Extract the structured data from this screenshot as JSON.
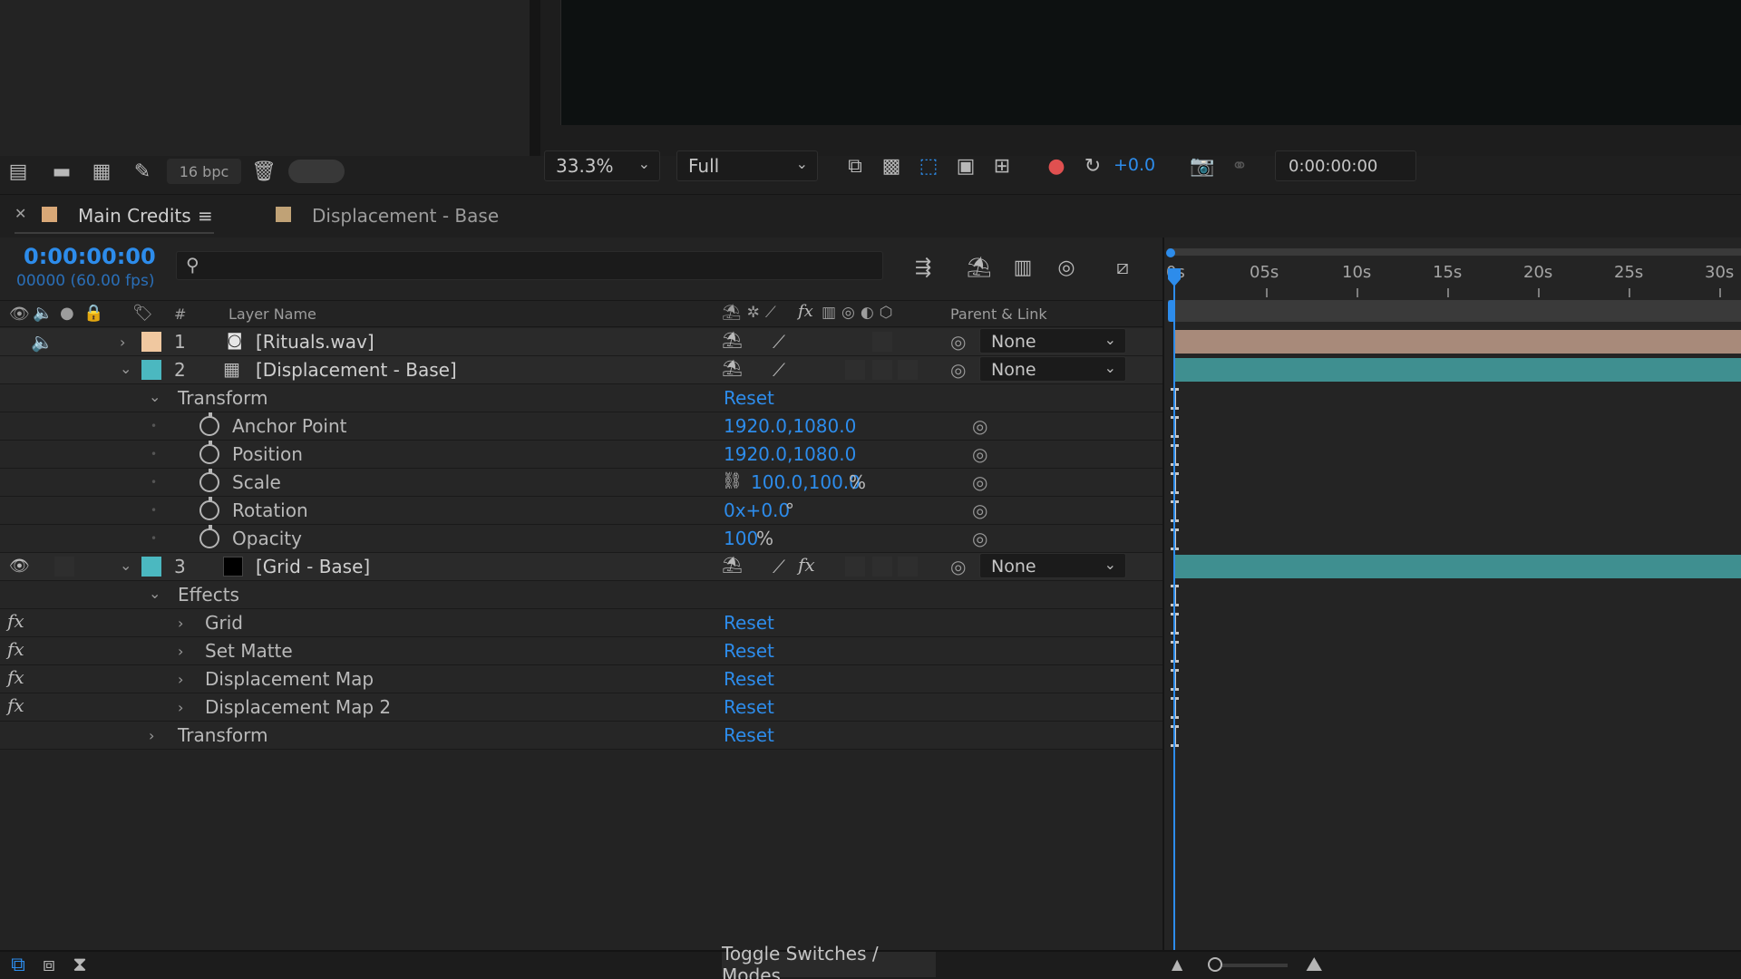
{
  "project_panel": {
    "bpc_label": "16 bpc"
  },
  "viewer": {
    "zoom": "33.3%",
    "resolution": "Full",
    "exposure": "+0.0",
    "timecode": "0:00:00:00"
  },
  "tabs": [
    {
      "label": "Main Credits",
      "active": true,
      "color": "#d9a877"
    },
    {
      "label": "Displacement - Base",
      "active": false,
      "color": "#c0a276"
    }
  ],
  "timeline": {
    "current_time": "0:00:00:00",
    "frame_info": "00000 (60.00 fps)",
    "search_placeholder": "",
    "columns": {
      "number": "#",
      "layer_name": "Layer Name",
      "parent": "Parent & Link"
    },
    "ruler": [
      "0s",
      "05s",
      "10s",
      "15s",
      "20s",
      "25s",
      "30s"
    ],
    "layers": [
      {
        "index": "1",
        "name": "[Rituals.wav]",
        "color": "#f0c8a0",
        "parent": "None",
        "bar_color": "#a88a7a"
      },
      {
        "index": "2",
        "name": "[Displacement - Base]",
        "color": "#4bb8c0",
        "parent": "None",
        "bar_color": "#3f8f90"
      },
      {
        "index": "3",
        "name": "[Grid - Base]",
        "color": "#4bb8c0",
        "parent": "None",
        "bar_color": "#3f8f90"
      }
    ],
    "transform": {
      "group_label": "Transform",
      "reset": "Reset",
      "anchor_point": {
        "label": "Anchor Point",
        "value": "1920.0,1080.0"
      },
      "position": {
        "label": "Position",
        "value": "1920.0,1080.0"
      },
      "scale": {
        "label": "Scale",
        "value": "100.0,100.0",
        "unit": "%"
      },
      "rotation": {
        "label": "Rotation",
        "value": "0x+0.0",
        "unit": "°"
      },
      "opacity": {
        "label": "Opacity",
        "value": "100",
        "unit": "%"
      }
    },
    "effects": {
      "group_label": "Effects",
      "items": [
        "Grid",
        "Set Matte",
        "Displacement Map",
        "Displacement Map 2"
      ],
      "reset": "Reset",
      "transform_label": "Transform"
    }
  },
  "status_bar": {
    "toggle_label": "Toggle Switches / Modes"
  },
  "colors": {
    "accent_blue": "#2d8ceb",
    "panel_bg": "#232323"
  }
}
